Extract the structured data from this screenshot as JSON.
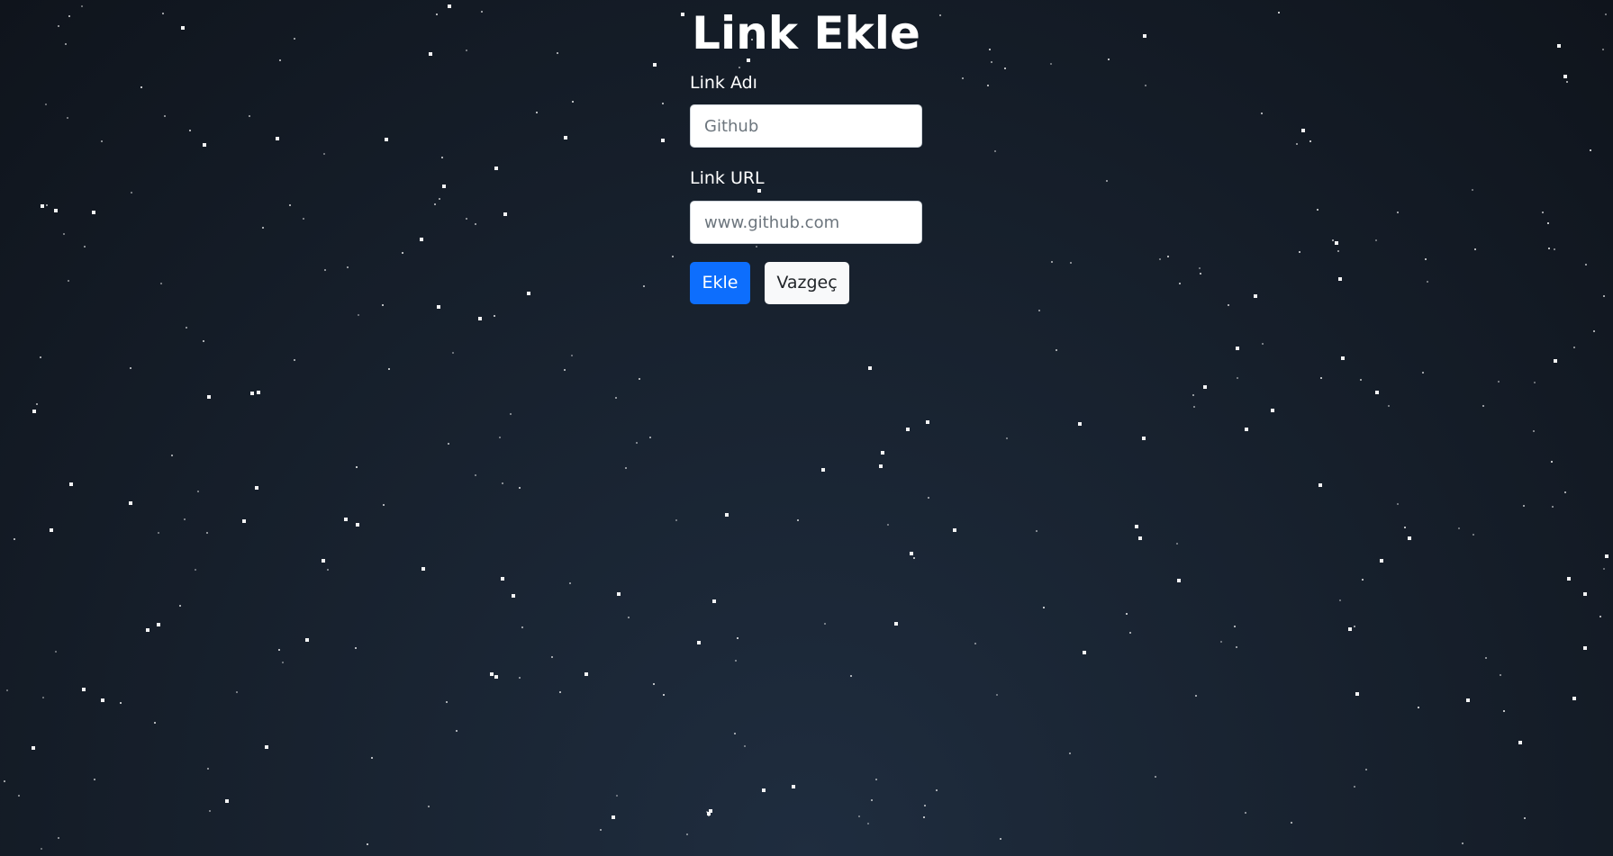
{
  "page": {
    "title": "Link Ekle"
  },
  "form": {
    "name_label": "Link Adı",
    "name_placeholder": "Github",
    "name_value": "",
    "url_label": "Link URL",
    "url_placeholder": "www.github.com",
    "url_value": "",
    "submit_label": "Ekle",
    "cancel_label": "Vazgeç"
  },
  "colors": {
    "background_center": "#1f2d3f",
    "background_edge": "#0f141c",
    "primary": "#0d6efd",
    "secondary_button": "#f8f9fa",
    "star": "#ffffff"
  }
}
